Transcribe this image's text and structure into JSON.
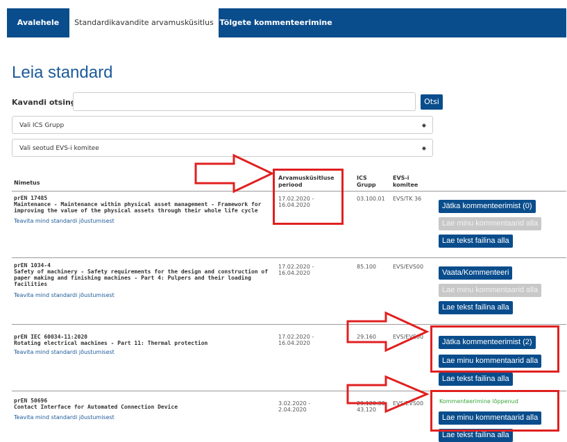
{
  "nav": {
    "tabs": [
      {
        "label": "Avalehele"
      },
      {
        "label": "Standardikavandite arvamusküsitlus"
      },
      {
        "label": "Tõlgete kommenteerimine"
      }
    ]
  },
  "page_title": "Leia standard",
  "search": {
    "label": "Kavandi otsing:",
    "value": "",
    "button": "Otsi"
  },
  "filters": {
    "ics_group": "Vali ICS Grupp",
    "committee": "Vali seotud EVS-i komitee"
  },
  "table": {
    "headers": {
      "name": "Nimetus",
      "period": "Arvamusküsitluse periood",
      "ics": "ICS Grupp",
      "committee": "EVS-i komitee"
    },
    "rows": [
      {
        "code": "prEN 17485",
        "title": "Maintenance - Maintenance within physical asset management - Framework for improving the value of the physical assets through their whole life cycle",
        "notify": "Teavita mind standardi jõustumisest",
        "period": "17.02.2020 - 16.04.2020",
        "ics": "03.100.01",
        "committee": "EVS/TK 36",
        "actions": [
          "Jätka kommenteerimist (0)",
          "Lae minu kommentaarid alla",
          "Lae tekst failina alla"
        ]
      },
      {
        "code": "prEN 1034-4",
        "title": "Safety of machinery - Safety requirements for the design and construction of paper making and finishing machines - Part 4: Pulpers and their loading facilities",
        "notify": "Teavita mind standardi jõustumisest",
        "period": "17.02.2020 - 16.04.2020",
        "ics": "85.100",
        "committee": "EVS/EVS00",
        "actions": [
          "Vaata/Kommenteeri",
          "Lae minu kommentaarid alla",
          "Lae tekst failina alla"
        ]
      },
      {
        "code": "prEN IEC 60034-11:2020",
        "title": "Rotating electrical machines - Part 11: Thermal protection",
        "notify": "Teavita mind standardi jõustumisest",
        "period": "17.02.2020 - 16.04.2020",
        "ics": "29.160",
        "committee": "EVS/EVS00",
        "actions": [
          "Jätka kommenteerimist (2)",
          "Lae minu kommentaarid alla",
          "Lae tekst failina alla"
        ]
      },
      {
        "code": "prEN 50696",
        "title": "Contact Interface for Automated Connection Device",
        "notify": "Teavita mind standardi jõustumisest",
        "period": "3.02.2020 - 2.04.2020",
        "ics": "29.120.30 43.120",
        "committee": "EVS/EVS00",
        "status": "Kommenteerimine lõppenud",
        "actions": [
          "Lae minu kommentaarid alla",
          "Lae tekst failina alla"
        ]
      }
    ]
  },
  "colors": {
    "nav": "#0a4d8c",
    "accent": "#1b5a99",
    "annotation": "#e02020",
    "status_ended": "#37a437"
  }
}
